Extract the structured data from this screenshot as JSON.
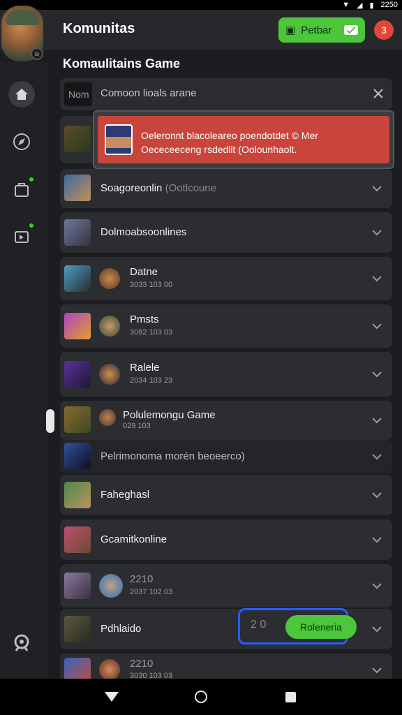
{
  "app": {
    "title": "Komunitas",
    "section_title": "Komaulitains Game",
    "header_button_label": "Petbar",
    "notification_count": "3"
  },
  "status": {
    "time": "2250"
  },
  "search": {
    "thumb_text": "Nom",
    "text": "Comoon lioals arane"
  },
  "toast": {
    "line1": "Oeleronnt blacoleareo poendotdet  © Mer",
    "line2": "Oececeeceng rsdedlit (Oolounhaolt."
  },
  "rows": [
    {
      "title": "Soagoreonlin",
      "title_suffix": "(Ootlcoune"
    },
    {
      "title": "Dolmoabsoonlines"
    },
    {
      "title": "Datne",
      "sub": "3033 103 00"
    },
    {
      "title": "Pmsts",
      "sub": "3082 103 03"
    },
    {
      "title": "Ralele",
      "sub": "2034 103 23"
    },
    {
      "title": "Polulemongu Game",
      "sub": "029 103"
    },
    {
      "title": "Pelrimonoma morén beoeerco)"
    },
    {
      "title": "Faheghasl"
    },
    {
      "title": "Gcamitkonline"
    },
    {
      "title": "2210",
      "sub": "2037 102 03"
    },
    {
      "title": "Pdhlaido"
    },
    {
      "title": "2210",
      "sub": "3030 103 03"
    }
  ],
  "join": {
    "count": "2 0",
    "label": "Roleneria"
  },
  "colors": {
    "accent_green": "#4cc63a",
    "alert_red": "#c9453b",
    "focus_blue": "#2a5cff"
  }
}
